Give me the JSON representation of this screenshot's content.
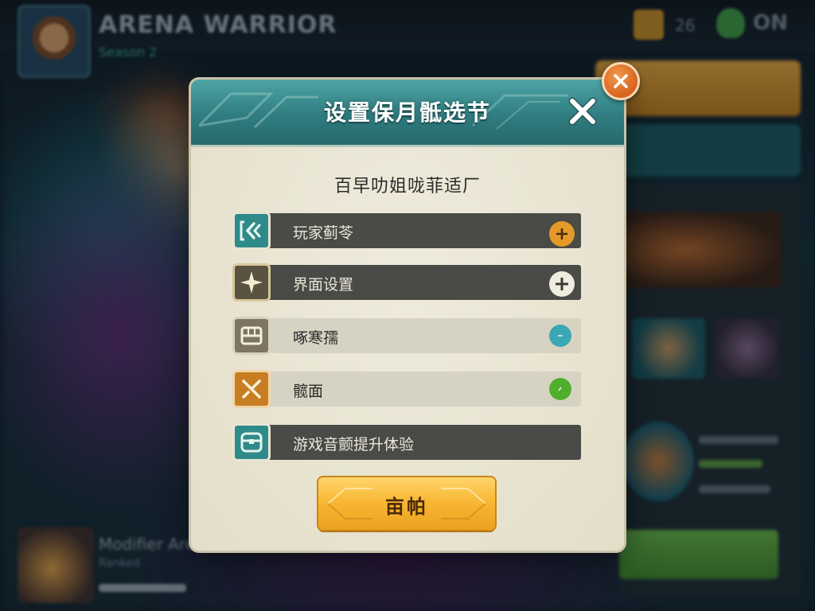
{
  "background": {
    "player_name": "ARENA WARRIOR",
    "player_sub": "Season 2",
    "top_text_1": "26",
    "top_text_2": "ON",
    "bottom_title": "Modifier Arena",
    "bottom_sub": "Ranked"
  },
  "dialog": {
    "title": "设置保月骶选节",
    "subtitle": "百早叻姐咙菲适厂",
    "options": [
      {
        "label": "玩家蓟苓",
        "icon": "back-arrow-icon",
        "control": "plus-button",
        "control_color": "#e39a28"
      },
      {
        "label": "界面设置",
        "icon": "sparkle-icon",
        "control": "plus-button",
        "control_color": "#efece0"
      },
      {
        "label": "啄寒孺",
        "icon": "chest-icon",
        "control": "toggle-dot",
        "control_color": "#3aa7b4"
      },
      {
        "label": "髋面",
        "icon": "crossed-swords-icon",
        "control": "toggle-dot",
        "control_color": "#4fae2c"
      },
      {
        "label": "游戏音颤提升体验",
        "icon": "treasure-box-icon",
        "control": "none"
      }
    ],
    "confirm_label": "亩帕"
  },
  "colors": {
    "header_teal": "#2f7d80",
    "panel_cream": "#e9e5d3",
    "confirm_gold": "#f7b531",
    "corner_close_orange": "#d8611e"
  }
}
